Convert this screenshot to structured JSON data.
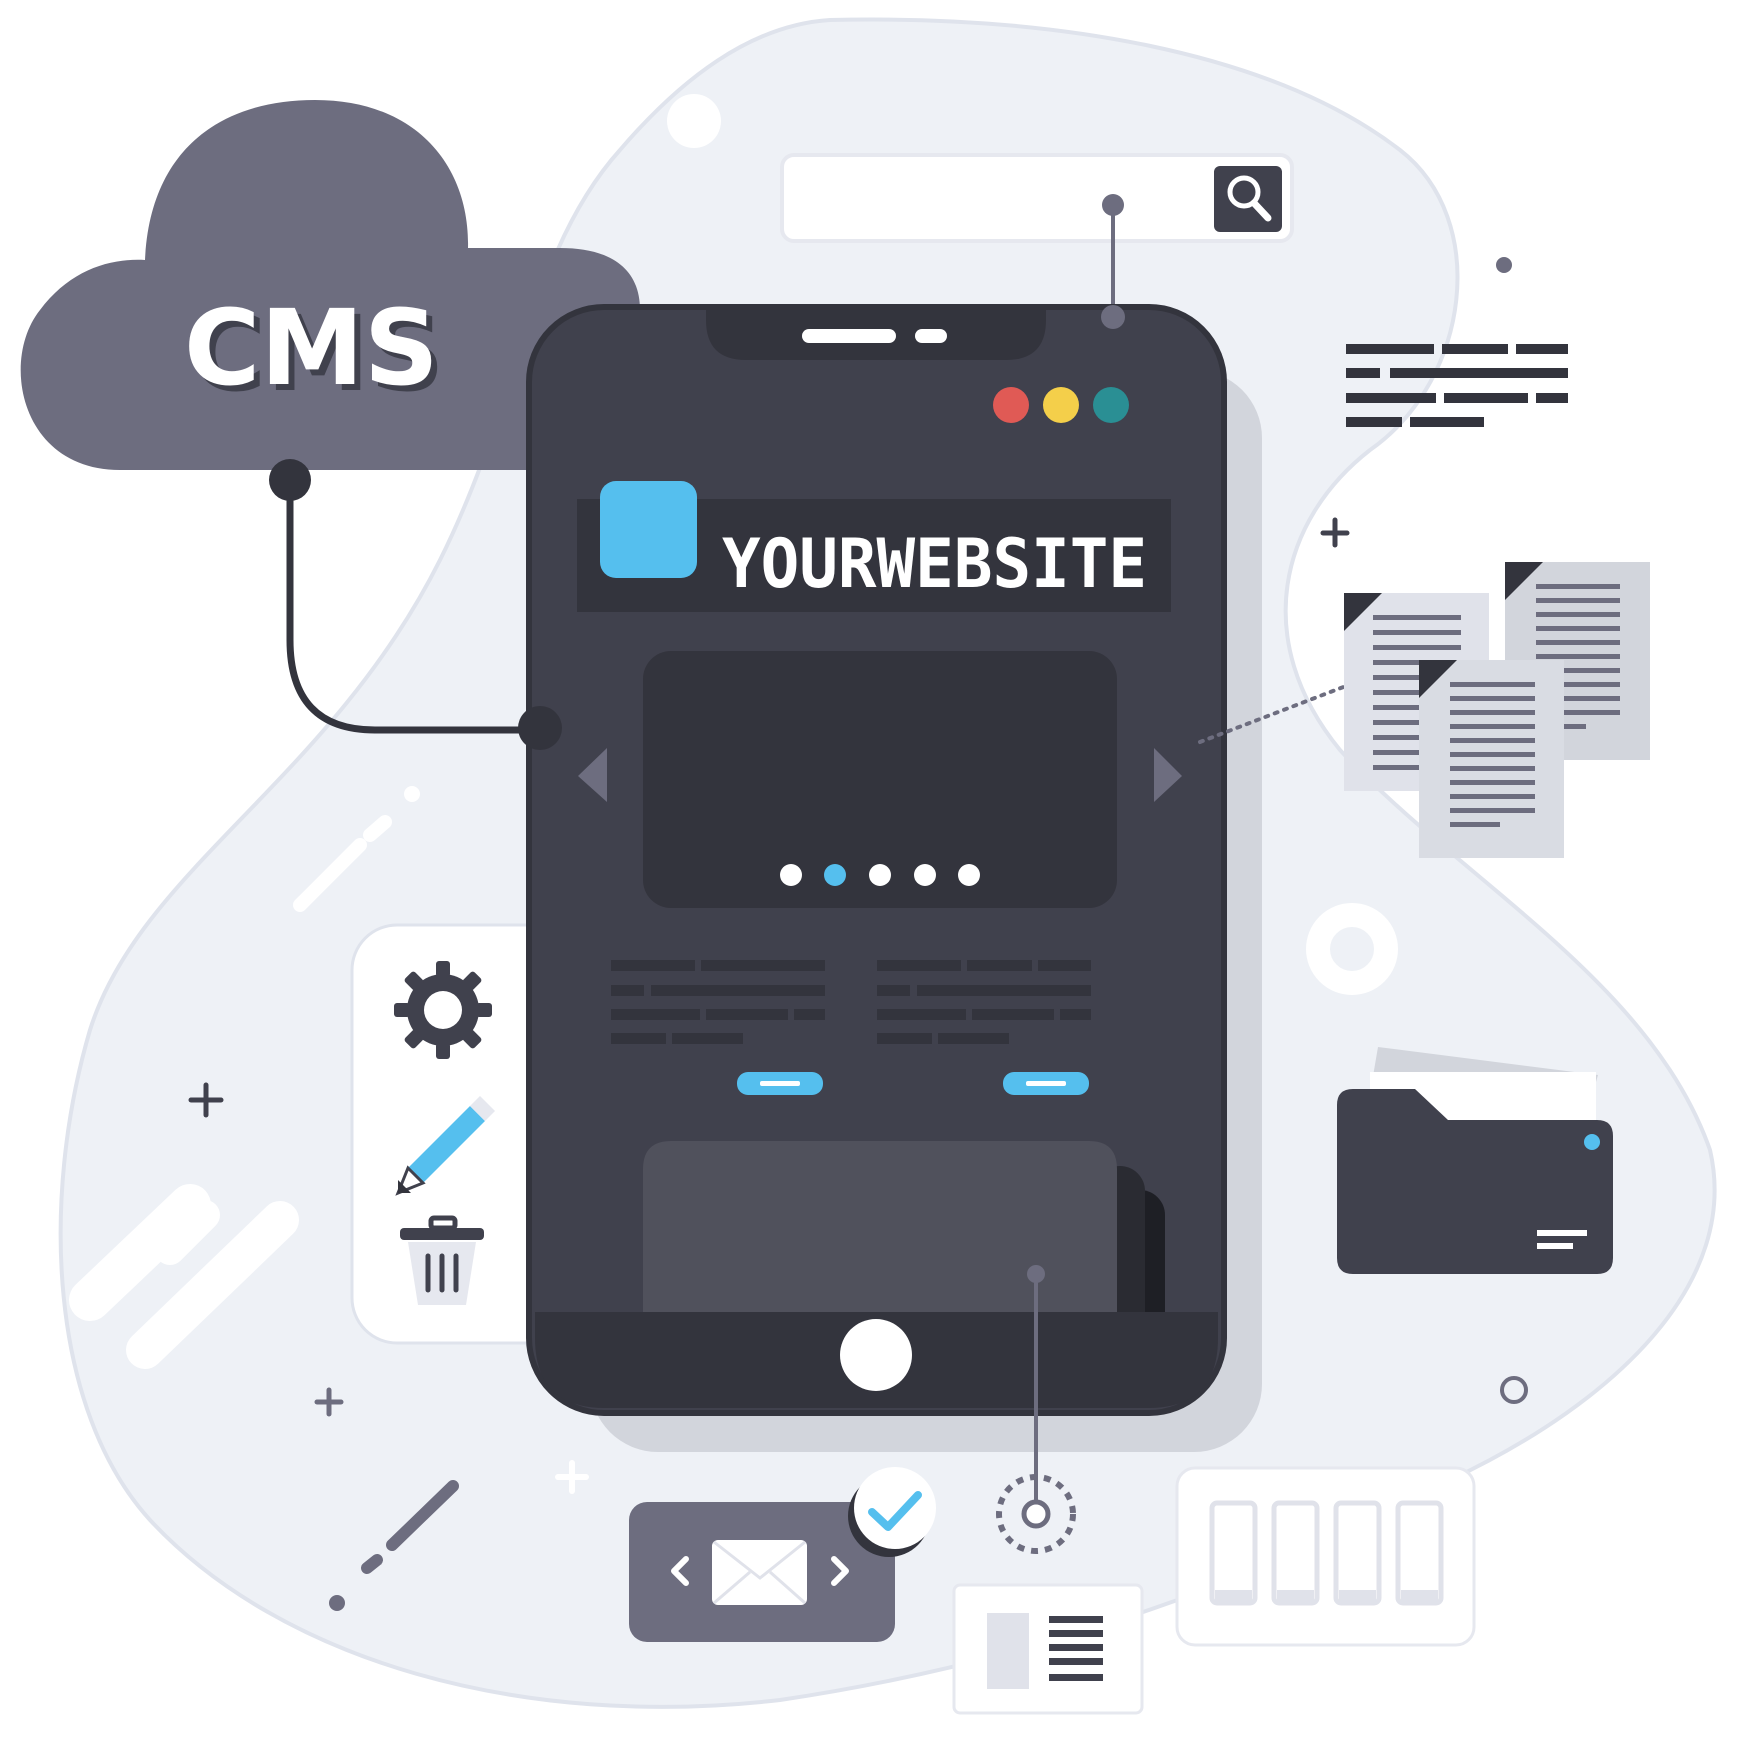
{
  "cloud": {
    "label": "CMS"
  },
  "phone": {
    "brand": "YOURWEBSITE",
    "window_dots": [
      "#e05a55",
      "#f4cf4a",
      "#2a8f94"
    ],
    "carousel": {
      "slides": 5,
      "active_slide": 2
    }
  },
  "colors": {
    "accent": "#55bfee",
    "phone_body": "#40414d",
    "cloud": "#6d6d7f",
    "blob": "#eef1f6"
  },
  "icons": {
    "search": "search-icon",
    "settings": "gear-icon",
    "edit": "pencil-icon",
    "delete": "trash-icon",
    "mail": "envelope-icon",
    "confirm": "checkmark-icon",
    "folder": "folder-icon",
    "documents": "documents-icon"
  }
}
